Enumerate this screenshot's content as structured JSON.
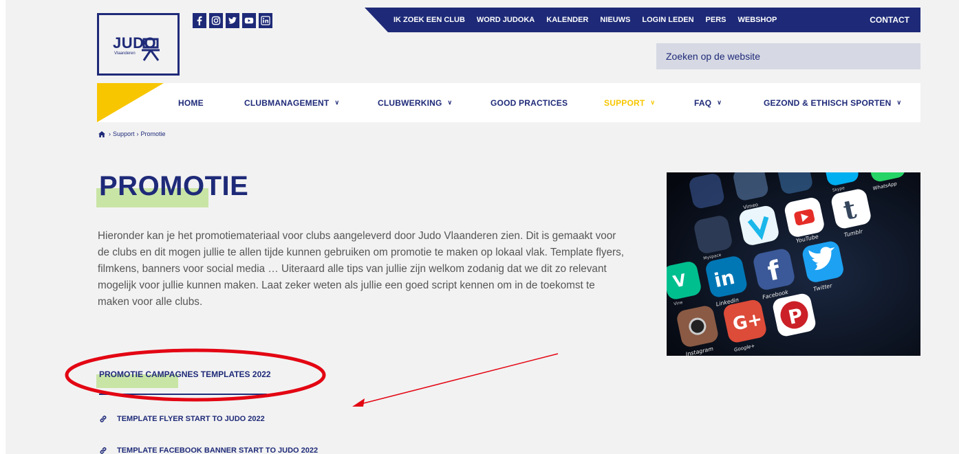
{
  "brand": {
    "name": "JUDO",
    "sub": "Vlaanderen"
  },
  "social": [
    "facebook-icon",
    "instagram-icon",
    "twitter-icon",
    "youtube-icon",
    "linkedin-icon"
  ],
  "topnav": {
    "items": [
      "IK ZOEK EEN CLUB",
      "WORD JUDOKA",
      "KALENDER",
      "NIEUWS",
      "LOGIN LEDEN",
      "PERS",
      "WEBSHOP"
    ],
    "contact": "CONTACT"
  },
  "search": {
    "placeholder": "Zoeken op de website"
  },
  "mainnav": {
    "home": "HOME",
    "clubmanagement": "CLUBMANAGEMENT",
    "clubwerking": "CLUBWERKING",
    "good_practices": "GOOD PRACTICES",
    "support": "SUPPORT",
    "faq": "FAQ",
    "gezond": "GEZOND & ETHISCH SPORTEN"
  },
  "breadcrumb": {
    "support": "Support",
    "current": "Promotie"
  },
  "page": {
    "title": "PROMOTIE",
    "intro": "Hieronder kan je het promotiemateriaal voor clubs aangeleverd door Judo Vlaanderen zien. Dit is gemaakt voor de clubs en dit mogen jullie te allen tijde kunnen gebruiken om promotie te maken op lokaal vlak. Template flyers, filmkens, banners voor social media …  Uiteraard alle tips van jullie zijn welkom zodanig dat we dit zo relevant mogelijk voor jullie kunnen maken. Laat zeker weten als jullie een goed script kennen om in de toekomst te maken voor alle clubs."
  },
  "section": {
    "title": "PROMOTIE CAMPAGNES TEMPLATES 2022",
    "links": [
      "TEMPLATE FLYER START TO JUDO 2022",
      "TEMPLATE FACEBOOK BANNER START TO JUDO 2022"
    ]
  },
  "hero_labels": {
    "vimeo": "Vimeo",
    "youtube": "YouTube",
    "tumblr": "Tumblr",
    "linkedin": "Linkedin",
    "facebook": "Facebook",
    "twitter": "Twitter",
    "instagram": "Instagram",
    "googleplus": "Google+",
    "whatsapp": "WhatsApp",
    "skype": "Skype",
    "vine": "Vine",
    "myspace": "Myspace"
  },
  "colors": {
    "navy": "#1e2a78",
    "yellow": "#f7c600",
    "highlight": "#c9e5a6",
    "annotation": "#e30613"
  }
}
